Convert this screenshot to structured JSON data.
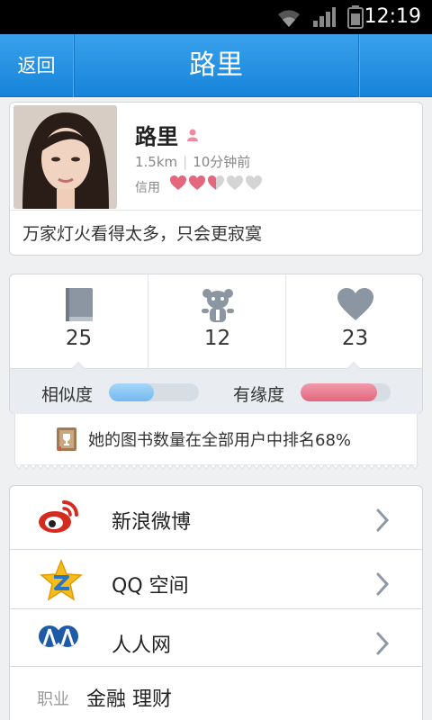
{
  "status_bar": {
    "time": "12:19",
    "icons": [
      "wifi-icon",
      "signal-icon",
      "battery-icon"
    ]
  },
  "header": {
    "back_label": "返回",
    "title": "路里"
  },
  "profile": {
    "name": "路里",
    "distance": "1.5km",
    "last_active": "10分钟前",
    "credit_label": "信用",
    "credit_hearts_filled": 2.5,
    "credit_hearts_total": 5,
    "signature": "万家灯火看得太多，只会更寂寞"
  },
  "stats": {
    "items": [
      {
        "icon": "book-icon",
        "value": "25"
      },
      {
        "icon": "teddy-bear-icon",
        "value": "12"
      },
      {
        "icon": "heart-icon",
        "value": "23"
      }
    ],
    "similarity_label": "相似度",
    "similarity_level": 0.5,
    "affinity_label": "有缘度",
    "affinity_level": 0.85
  },
  "rank": {
    "icon": "trophy-book-icon",
    "text": "她的图书数量在全部用户中排名68%"
  },
  "links": [
    {
      "icon": "sina-weibo-icon",
      "label": "新浪微博"
    },
    {
      "icon": "qq-zone-icon",
      "label": "QQ 空间"
    },
    {
      "icon": "renren-icon",
      "label": "人人网"
    }
  ],
  "job": {
    "label": "职业",
    "value": "金融 理财"
  },
  "colors": {
    "header_blue": "#1e8fe3",
    "similarity_bar": "#72b9ef",
    "affinity_bar": "#e2667d",
    "heart_pink": "#e3687e",
    "heart_gray": "#d4d4d4"
  }
}
